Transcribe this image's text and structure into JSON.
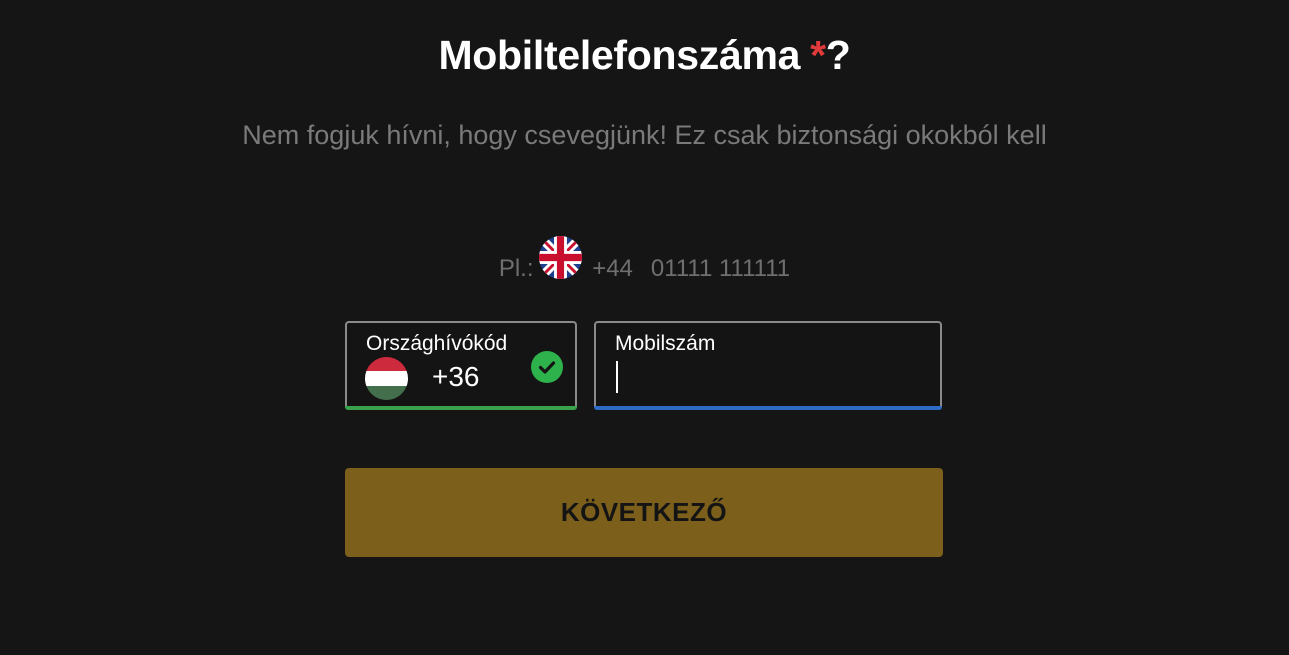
{
  "header": {
    "title": "Mobiltelefonszáma",
    "required_mark": "*",
    "question_mark": "?",
    "subtitle": "Nem fogjuk hívni, hogy csevegjünk! Ez csak biztonsági okokból kell"
  },
  "example": {
    "prefix": "Pl.:",
    "flag": "uk-flag-icon",
    "dial_code": "+44",
    "number": "01111 111111"
  },
  "country_field": {
    "label": "Országhívókód",
    "flag": "hungary-flag-icon",
    "value": "+36",
    "status": "valid",
    "status_color": "#2eb24b"
  },
  "phone_field": {
    "label": "Mobilszám",
    "value": "",
    "focused": true,
    "focus_color": "#2d6bc4"
  },
  "actions": {
    "next_label": "KÖVETKEZŐ",
    "next_color": "#7c5f1a"
  }
}
